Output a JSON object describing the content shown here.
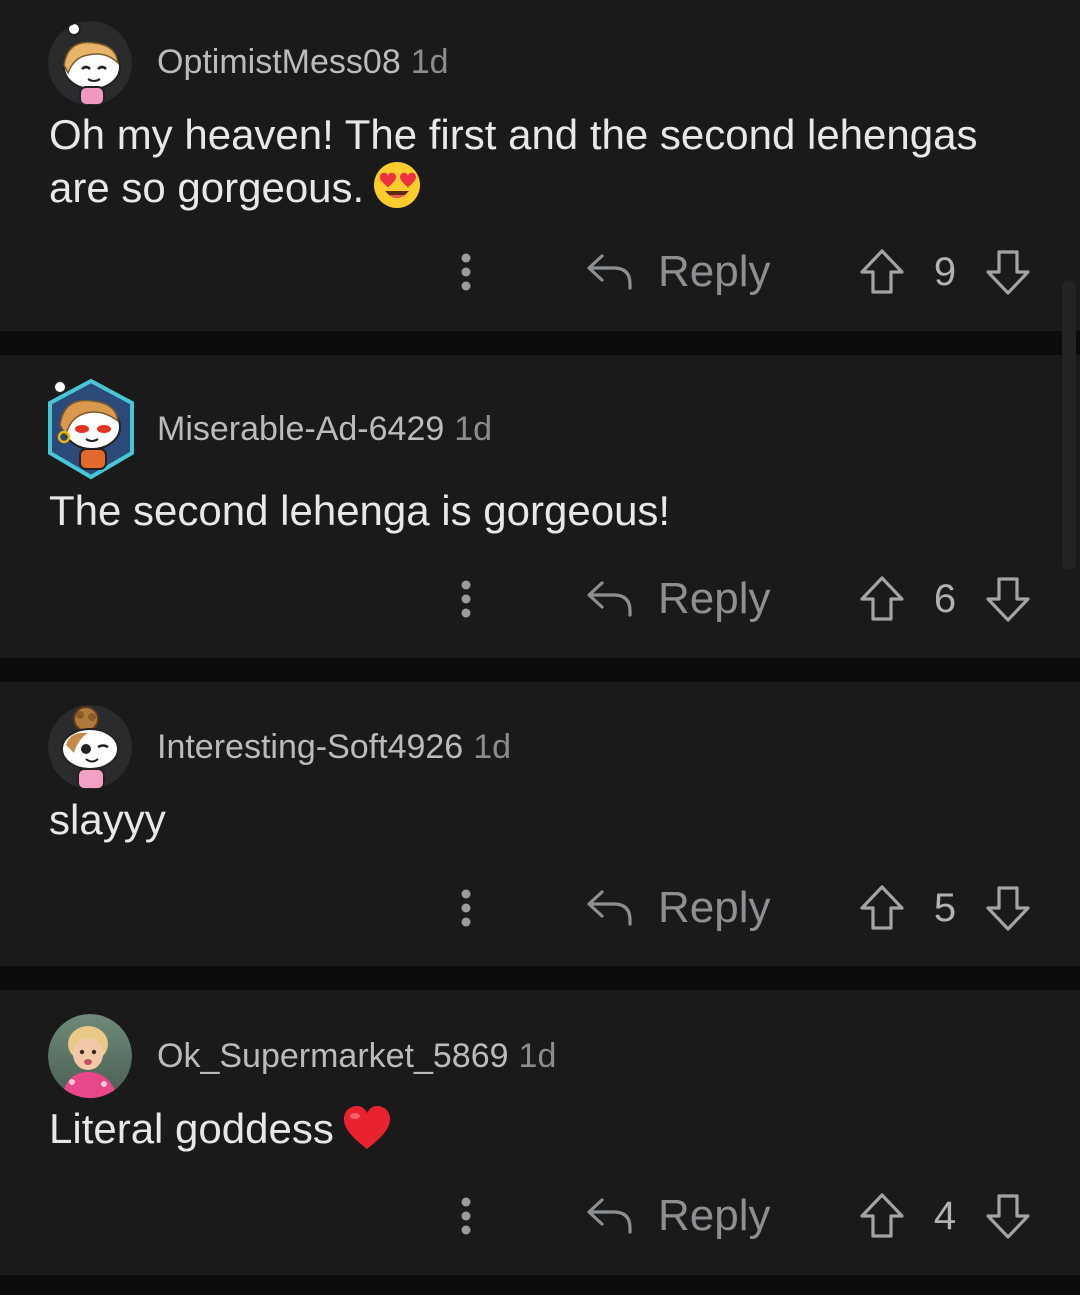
{
  "comments": [
    {
      "username": "OptimistMess08",
      "age": "1d",
      "text": "Oh my heaven! The first and the second lehengas are so gorgeous.",
      "emoji": "smiling-face-with-heart-eyes",
      "reply_label": "Reply",
      "score": "9",
      "avatar": "snoo-avatar-blonde"
    },
    {
      "username": "Miserable-Ad-6429",
      "age": "1d",
      "text": "The second lehenga is gorgeous!",
      "reply_label": "Reply",
      "score": "6",
      "avatar": "snoo-avatar-hexagon-frame"
    },
    {
      "username": "Interesting-Soft4926",
      "age": "1d",
      "text": "slayyy",
      "reply_label": "Reply",
      "score": "5",
      "avatar": "snoo-avatar-curly-bun"
    },
    {
      "username": "Ok_Supermarket_5869",
      "age": "1d",
      "text": "Literal goddess",
      "emoji": "red-heart",
      "reply_label": "Reply",
      "score": "4",
      "avatar": "photo-avatar-child"
    }
  ],
  "colors": {
    "background": "#0b0b0b",
    "card": "#1a1a1b",
    "username": "#b9bbbd",
    "body_text": "#e6e8ea",
    "icon": "#8d9092"
  }
}
